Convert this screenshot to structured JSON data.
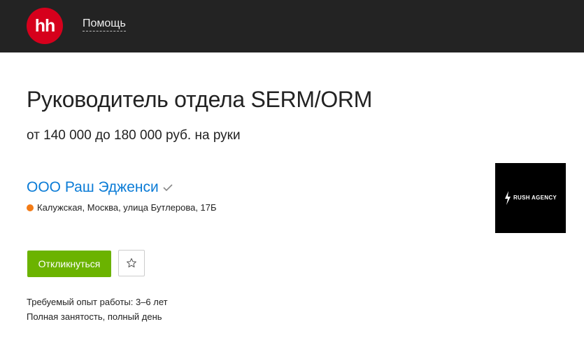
{
  "header": {
    "logo_text": "hh",
    "help_link": "Помощь"
  },
  "vacancy": {
    "title": "Руководитель отдела SERM/ORM",
    "salary": "от 140 000 до 180 000 руб. на руки",
    "company_name": "ООО Раш Эдженси",
    "address": "Калужская, Москва, улица Бутлерова, 17Б",
    "company_logo_text": "RUSH AGENCY",
    "apply_button": "Откликнуться",
    "experience": "Требуемый опыт работы: 3–6 лет",
    "employment": "Полная занятость, полный день"
  },
  "colors": {
    "brand_red": "#d6001c",
    "header_bg": "#232323",
    "link_blue": "#0a7bd6",
    "apply_green": "#6bb300",
    "metro_orange": "#f37b16"
  },
  "icons": {
    "verified": "check-icon",
    "favorite": "star-icon",
    "metro": "metro-dot-icon"
  }
}
